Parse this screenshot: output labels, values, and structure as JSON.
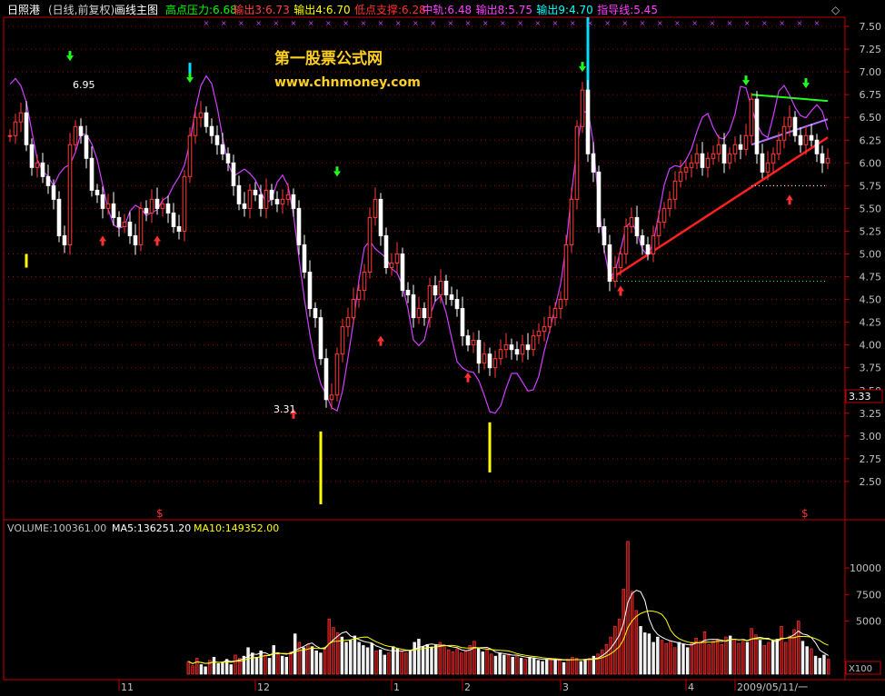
{
  "header": {
    "stock": "日照港",
    "period": "(日线,前复权)",
    "indicator": "画线主图",
    "items": [
      {
        "label": "高点压力:6.68",
        "color": "#00ff00"
      },
      {
        "label": "输出3:6.73",
        "color": "#ff4040"
      },
      {
        "label": "输出4:6.70",
        "color": "#ffff00"
      },
      {
        "label": "低点支撑:6.28",
        "color": "#ff3030"
      },
      {
        "label": "中轨:6.48",
        "color": "#ff40ff"
      },
      {
        "label": "输出8:5.75",
        "color": "#ff40ff"
      },
      {
        "label": "输出9:4.70",
        "color": "#00ffff"
      },
      {
        "label": "指导线:5.45",
        "color": "#ff40ff"
      }
    ]
  },
  "watermark": {
    "title": "第一股票公式网",
    "url": "www.chnmoney.com"
  },
  "annotations": {
    "high_label": "6.95",
    "low_label": "3.31",
    "current_price": "3.33",
    "marker": "$"
  },
  "volume_header": {
    "volume": "VOLUME:100361.00",
    "ma5": "MA5:136251.20",
    "ma10": "MA10:149352.00"
  },
  "volume_unit": "X100",
  "x_axis": {
    "months": [
      {
        "label": "11",
        "index": 20
      },
      {
        "label": "12",
        "index": 45
      },
      {
        "label": "1",
        "index": 70
      },
      {
        "label": "2",
        "index": 83
      },
      {
        "label": "3",
        "index": 101
      },
      {
        "label": "4",
        "index": 124
      },
      {
        "label": "2009/05/11/一",
        "index": 133
      }
    ]
  },
  "colors": {
    "up": "#ff3c3c",
    "down": "#ffffff",
    "grid": "#a00000",
    "axis": "#c00000",
    "envelope": "#d040ff",
    "trend": "#ff2020",
    "resist": "#20ff20",
    "mid": "#b070ff",
    "ma5": "#ffffff",
    "ma10": "#ffff00"
  },
  "chart_data": [
    {
      "type": "candlestick",
      "y_ticks": [
        2.5,
        2.75,
        3.0,
        3.25,
        3.5,
        3.75,
        4.0,
        4.25,
        4.5,
        4.75,
        5.0,
        5.25,
        5.5,
        5.75,
        6.0,
        6.25,
        6.5,
        6.75,
        7.0,
        7.25,
        7.5
      ],
      "ylim": [
        2.2,
        7.6
      ],
      "closes": [
        6.3,
        6.45,
        6.55,
        6.2,
        5.95,
        6.0,
        5.85,
        5.75,
        5.6,
        5.2,
        5.1,
        6.2,
        6.4,
        6.3,
        6.05,
        5.7,
        5.65,
        5.5,
        5.55,
        5.4,
        5.3,
        5.35,
        5.2,
        5.1,
        5.5,
        5.45,
        5.6,
        5.5,
        5.55,
        5.45,
        5.3,
        5.25,
        5.85,
        6.3,
        6.5,
        6.55,
        6.4,
        6.3,
        6.2,
        6.1,
        6.0,
        5.75,
        5.55,
        5.5,
        5.7,
        5.65,
        5.5,
        5.7,
        5.6,
        5.55,
        5.6,
        5.65,
        5.5,
        5.1,
        4.8,
        4.4,
        4.3,
        3.85,
        3.4,
        3.45,
        3.9,
        4.2,
        4.3,
        4.5,
        4.6,
        4.8,
        5.4,
        5.6,
        5.2,
        4.85,
        4.9,
        5.0,
        4.6,
        4.55,
        4.3,
        4.4,
        4.3,
        4.65,
        4.55,
        4.7,
        4.55,
        4.5,
        4.4,
        4.1,
        4.0,
        4.05,
        3.8,
        3.9,
        3.75,
        3.85,
        3.95,
        4.0,
        3.95,
        3.9,
        4.0,
        3.95,
        4.1,
        4.15,
        4.2,
        4.3,
        4.4,
        4.5,
        5.1,
        5.6,
        6.4,
        6.8,
        6.1,
        5.9,
        5.3,
        5.1,
        4.7,
        4.85,
        5.0,
        5.3,
        5.4,
        5.2,
        5.1,
        5.0,
        5.2,
        5.35,
        5.5,
        5.6,
        5.8,
        5.9,
        5.95,
        6.0,
        6.1,
        5.95,
        6.05,
        6.1,
        6.2,
        6.0,
        6.1,
        6.2,
        6.15,
        6.3,
        6.7,
        6.1,
        5.9,
        6.0,
        6.1,
        6.25,
        6.4,
        6.5,
        6.3,
        6.2,
        6.3,
        6.25,
        6.1,
        6.0,
        6.05
      ]
    },
    {
      "type": "bar",
      "title": "VOLUME",
      "y_ticks": [
        5000,
        7500,
        10000
      ],
      "ylim": [
        0,
        13000
      ],
      "values": [
        1200,
        800,
        1500,
        900,
        700,
        1300,
        1600,
        1000,
        1100,
        1400,
        900,
        1800,
        1500,
        1700,
        2500,
        2000,
        1600,
        2200,
        1800,
        1500,
        2700,
        1900,
        1700,
        1600,
        2100,
        3800,
        3000,
        2500,
        2800,
        2600,
        2200,
        2000,
        2400,
        5200,
        4400,
        3900,
        3500,
        3000,
        3200,
        3600,
        3000,
        2700,
        2500,
        2900,
        2200,
        2300,
        1800,
        2000,
        2600,
        2400,
        2100,
        2000,
        2200,
        3000,
        3300,
        2600,
        2800,
        2500,
        2700,
        3000,
        2700,
        2300,
        2100,
        2400,
        2000,
        2200,
        2700,
        3100,
        2400,
        2100,
        2300,
        1900,
        1700,
        2000,
        1800,
        1900,
        1600,
        1700,
        1500,
        1400,
        1600,
        1500,
        1300,
        1200,
        1400,
        1500,
        1400,
        1300,
        1100,
        1400,
        1600,
        1500,
        1200,
        1300,
        1500,
        1700,
        1900,
        2300,
        2800,
        3500,
        4500,
        5200,
        8000,
        12500,
        7800,
        6000,
        4500,
        3900,
        3800,
        3000,
        3500,
        3200,
        2900,
        3100,
        2500,
        3000,
        2800,
        2500,
        3000,
        3400,
        3100,
        4000,
        2800,
        3100,
        3300,
        2800,
        3500,
        3600,
        3300,
        2900,
        3100,
        3000,
        4300,
        3700,
        3200,
        2700,
        3000,
        3100,
        3300,
        4500,
        3000,
        3600,
        4200,
        5000,
        3100,
        2600,
        2400,
        1700,
        1500,
        1800,
        1400
      ]
    }
  ]
}
